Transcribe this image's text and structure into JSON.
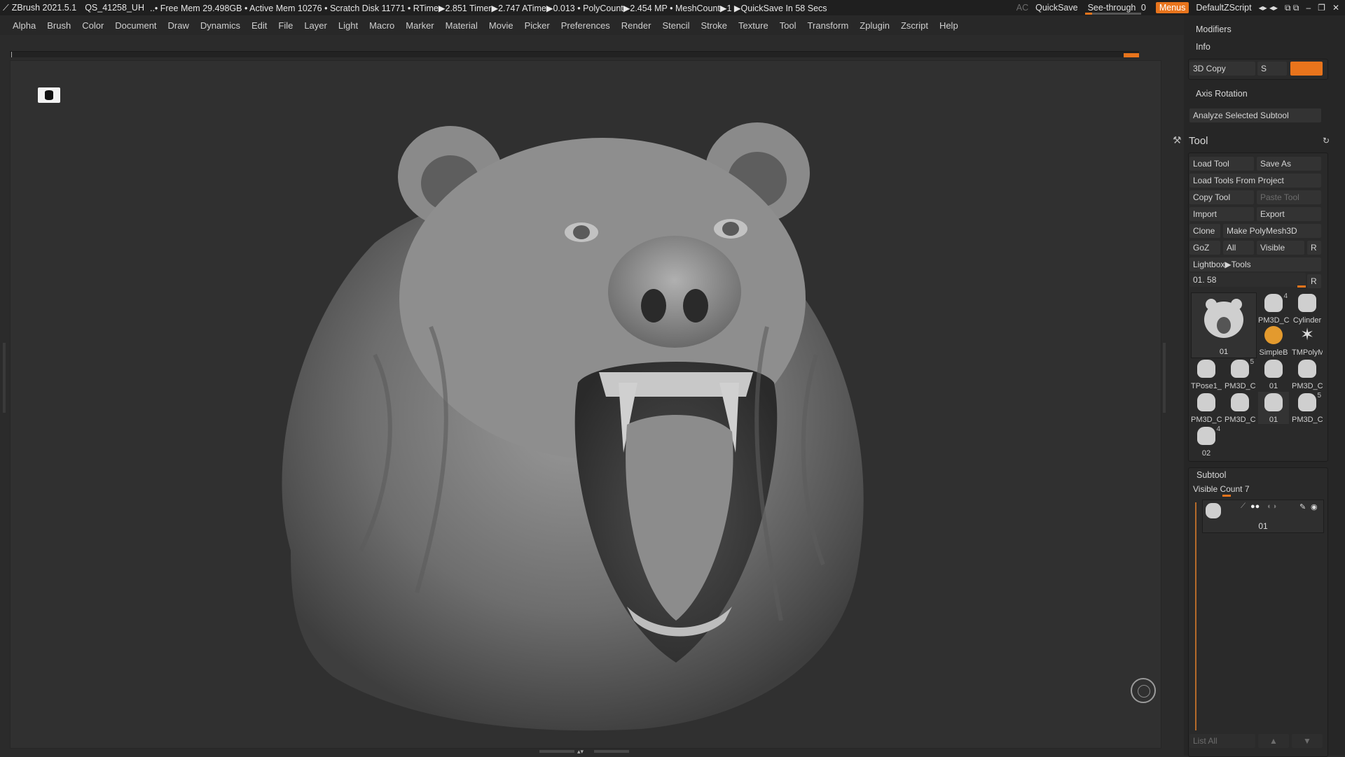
{
  "titlebar": {
    "app": "ZBrush 2021.5.1",
    "doc": "QS_41258_UH",
    "stats": "..• Free Mem 29.498GB • Active Mem 10276 • Scratch Disk 11771 • RTime▶2.851 Timer▶2.747 ATime▶0.013 • PolyCount▶2.454 MP • MeshCount▶1 ▶QuickSave In 58 Secs",
    "ac": "AC",
    "quicksave": "QuickSave",
    "seethrough_label": "See-through",
    "seethrough_value": "0",
    "menus": "Menus",
    "script": "DefaultZScript",
    "accent": "#e8741c"
  },
  "menubar": {
    "items": [
      "Alpha",
      "Brush",
      "Color",
      "Document",
      "Draw",
      "Dynamics",
      "Edit",
      "File",
      "Layer",
      "Light",
      "Macro",
      "Marker",
      "Material",
      "Movie",
      "Picker",
      "Preferences",
      "Render",
      "Stencil",
      "Stroke",
      "Texture",
      "Tool",
      "Transform",
      "Zplugin",
      "Zscript",
      "Help"
    ]
  },
  "panel": {
    "modifiers": "Modifiers",
    "info": "Info",
    "copy3d": "3D Copy",
    "s_label": "S",
    "axis_rotation": "Axis Rotation",
    "analyze": "Analyze Selected Subtool",
    "tool_title": "Tool",
    "load_tool": "Load Tool",
    "save_as": "Save As",
    "load_from_project": "Load Tools From Project",
    "copy_tool": "Copy Tool",
    "paste_tool": "Paste Tool",
    "import": "Import",
    "export": "Export",
    "clone": "Clone",
    "make_polymesh": "Make PolyMesh3D",
    "goz": "GoZ",
    "all": "All",
    "visible": "Visible",
    "r": "R",
    "lightbox_tools": "Lightbox▶Tools",
    "current_tool_value": "01. 58",
    "r2": "R",
    "main_thumb_label": "01",
    "thumbs": [
      {
        "label": "PM3D_C",
        "num": "4"
      },
      {
        "label": "Cylinder",
        "num": ""
      },
      {
        "label": "SimpleB",
        "num": ""
      },
      {
        "label": "TMPolyM",
        "num": ""
      },
      {
        "label": "TPose1_",
        "num": ""
      },
      {
        "label": "PM3D_C",
        "num": "5"
      },
      {
        "label": "01",
        "num": ""
      },
      {
        "label": "PM3D_C",
        "num": ""
      },
      {
        "label": "PM3D_C",
        "num": ""
      },
      {
        "label": "PM3D_C",
        "num": ""
      },
      {
        "label": "01",
        "num": ""
      },
      {
        "label": "PM3D_C",
        "num": "5"
      },
      {
        "label": "02",
        "num": "4"
      }
    ],
    "subtool_title": "Subtool",
    "visible_count": "Visible Count 7",
    "subtool_item_label": "01",
    "list_all": "List All"
  }
}
